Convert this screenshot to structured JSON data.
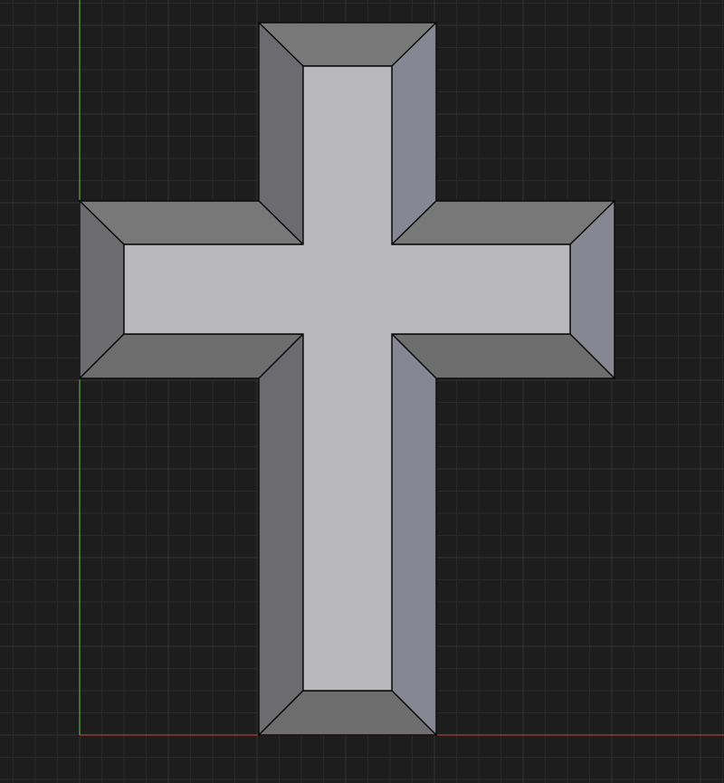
{
  "viewport": {
    "background": "#1d1d1d",
    "grid": {
      "visible": true,
      "minor_color": "#2a2a2a",
      "major_color": "#333333"
    },
    "axes": {
      "x_axis_color": "#8f3b32",
      "y_axis_color": "#4f8f3a"
    }
  },
  "mesh": {
    "shape": "cross-icon",
    "style": "beveled",
    "face_colors": {
      "top": "#b9b8bd",
      "bevel_upper": "#787878",
      "bevel_lower": "#6e6e6e",
      "bevel_left": "#6b6b70",
      "bevel_right": "#868792",
      "edge": "#0a0a0a"
    }
  }
}
